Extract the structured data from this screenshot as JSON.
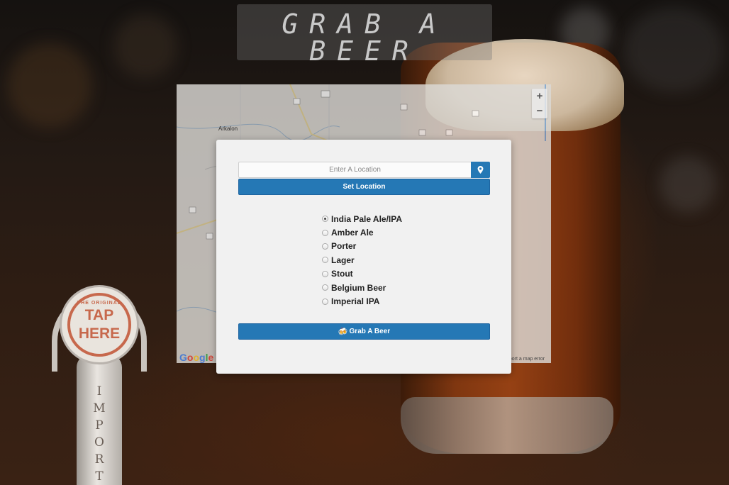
{
  "header": {
    "title_line1": "GRAB A",
    "title_line2": "BEER"
  },
  "tap_handle": {
    "tag_small": "THE ORIGINAL",
    "tag_line1": "TAP",
    "tag_line2": "HERE",
    "vertical_text": "IMPORT"
  },
  "map": {
    "town_label": "Arkalon",
    "zoom_in": "+",
    "zoom_out": "−",
    "google_logo": "Google",
    "footer_text": "eport a map error",
    "road_markers": [
      "54",
      "8",
      "6",
      "7",
      "8",
      "7",
      "8"
    ]
  },
  "form": {
    "location": {
      "placeholder": "Enter A Location",
      "value": "",
      "pin_icon": "map-marker-icon"
    },
    "set_location_label": "Set Location",
    "beer_types": [
      {
        "label": "India Pale Ale/IPA",
        "checked": true
      },
      {
        "label": "Amber Ale",
        "checked": false
      },
      {
        "label": "Porter",
        "checked": false
      },
      {
        "label": "Lager",
        "checked": false
      },
      {
        "label": "Stout",
        "checked": false
      },
      {
        "label": "Belgium Beer",
        "checked": false
      },
      {
        "label": "Imperial IPA",
        "checked": false
      }
    ],
    "grab_button": {
      "emoji": "🍻",
      "label": "Grab A Beer"
    }
  },
  "colors": {
    "primary_blue": "#2578b5",
    "modal_bg": "#f1f1f1",
    "tap_red": "#c7684c"
  }
}
